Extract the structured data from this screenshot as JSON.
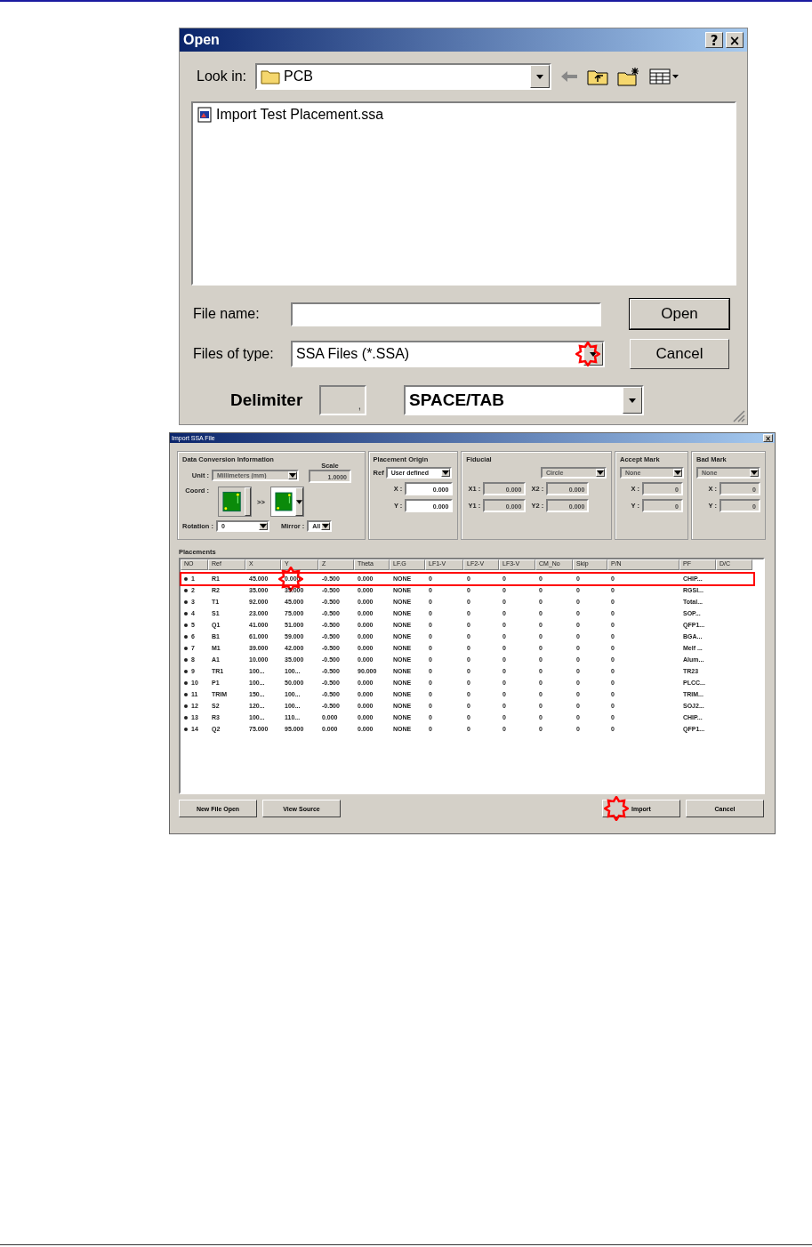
{
  "open_dialog": {
    "title": "Open",
    "title_buttons": [
      "?",
      "×"
    ],
    "look_in": {
      "label": "Look in:",
      "value": "PCB"
    },
    "files": [
      {
        "name": "Import Test Placement.ssa",
        "selected": false
      }
    ],
    "file_name": {
      "label": "File name:"
    },
    "files_of_type": {
      "label": "Files of type:",
      "value": "SSA Files (*.SSA)",
      "marked": true
    },
    "buttons": [
      {
        "label": "Open",
        "default": true
      },
      {
        "label": "Cancel",
        "default": false
      }
    ],
    "delimiter": {
      "label": "Delimiter",
      "char": ",",
      "disabled": true,
      "value": "SPACE/TAB"
    }
  },
  "import_dialog": {
    "title": "Import SSA File",
    "close": "×",
    "data_conversion": {
      "title": "Data Conversion Information",
      "unit": {
        "label": "Unit :",
        "value": "Millimeters (mm)",
        "disabled": true
      },
      "scale": {
        "label": "Scale",
        "value": "1.0000",
        "disabled": true
      },
      "coord": {
        "label": "Coord :",
        "arrow": ">>"
      },
      "rotation": {
        "label": "Rotation :",
        "value": "0",
        "disabled": false
      },
      "mirror": {
        "label": "Mirror :",
        "value": "All",
        "disabled": false
      }
    },
    "placement_origin": {
      "title": "Placement Origin",
      "ref": {
        "label": "Ref",
        "value": "User defined",
        "disabled": false
      },
      "fields": [
        {
          "label": "X :",
          "value": "0.000",
          "disabled": false
        },
        {
          "label": "Y :",
          "value": "0.000",
          "disabled": false
        }
      ]
    },
    "fiducial": {
      "title": "Fiducial",
      "shape": {
        "value": "Circle",
        "disabled": true
      },
      "fields": [
        {
          "label": "X1 :",
          "value": "0.000",
          "disabled": true
        },
        {
          "label": "X2 :",
          "value": "0.000",
          "disabled": true
        },
        {
          "label": "Y1 :",
          "value": "0.000",
          "disabled": true
        },
        {
          "label": "Y2 :",
          "value": "0.000",
          "disabled": true
        }
      ]
    },
    "accept_mark": {
      "title": "Accept Mark",
      "type": {
        "value": "None",
        "disabled": true
      },
      "fields": [
        {
          "label": "X :",
          "value": "0",
          "disabled": true
        },
        {
          "label": "Y :",
          "value": "0",
          "disabled": true
        }
      ]
    },
    "bad_mark": {
      "title": "Bad Mark",
      "type": {
        "value": "None",
        "disabled": true
      },
      "fields": [
        {
          "label": "X :",
          "value": "0",
          "disabled": true
        },
        {
          "label": "Y :",
          "value": "0",
          "disabled": true
        }
      ]
    },
    "placements": {
      "title": "Placements",
      "columns": [
        "NO",
        "Ref",
        "X",
        "Y",
        "Z",
        "Theta",
        "LF.G",
        "LF1-V",
        "LF2-V",
        "LF3-V",
        "CM_No",
        "Skip",
        "P/N",
        "PF",
        "D/C"
      ],
      "rows": [
        {
          "highlighted": true,
          "cells": [
            "1",
            "R1",
            "45.000",
            {
              "text": "0.000",
              "marked": true
            },
            "-0.500",
            "0.000",
            "NONE",
            "0",
            "0",
            "0",
            "0",
            "0",
            "0",
            "CHIP..."
          ]
        },
        {
          "highlighted": false,
          "cells": [
            "2",
            "R2",
            "35.000",
            "35.000",
            "-0.500",
            "0.000",
            "NONE",
            "0",
            "0",
            "0",
            "0",
            "0",
            "0",
            "RGSI..."
          ]
        },
        {
          "highlighted": false,
          "cells": [
            "3",
            "T1",
            "92.000",
            "45.000",
            "-0.500",
            "0.000",
            "NONE",
            "0",
            "0",
            "0",
            "0",
            "0",
            "0",
            "Total..."
          ]
        },
        {
          "highlighted": false,
          "cells": [
            "4",
            "S1",
            "23.000",
            "75.000",
            "-0.500",
            "0.000",
            "NONE",
            "0",
            "0",
            "0",
            "0",
            "0",
            "0",
            "SOP..."
          ]
        },
        {
          "highlighted": false,
          "cells": [
            "5",
            "Q1",
            "41.000",
            "51.000",
            "-0.500",
            "0.000",
            "NONE",
            "0",
            "0",
            "0",
            "0",
            "0",
            "0",
            "QFP1..."
          ]
        },
        {
          "highlighted": false,
          "cells": [
            "6",
            "B1",
            "61.000",
            "59.000",
            "-0.500",
            "0.000",
            "NONE",
            "0",
            "0",
            "0",
            "0",
            "0",
            "0",
            "BGA..."
          ]
        },
        {
          "highlighted": false,
          "cells": [
            "7",
            "M1",
            "39.000",
            "42.000",
            "-0.500",
            "0.000",
            "NONE",
            "0",
            "0",
            "0",
            "0",
            "0",
            "0",
            "Melf ..."
          ]
        },
        {
          "highlighted": false,
          "cells": [
            "8",
            "A1",
            "10.000",
            "35.000",
            "-0.500",
            "0.000",
            "NONE",
            "0",
            "0",
            "0",
            "0",
            "0",
            "0",
            "Alum..."
          ]
        },
        {
          "highlighted": false,
          "cells": [
            "9",
            "TR1",
            "100...",
            "100...",
            "-0.500",
            "90.000",
            "NONE",
            "0",
            "0",
            "0",
            "0",
            "0",
            "0",
            "TR23"
          ]
        },
        {
          "highlighted": false,
          "cells": [
            "10",
            "P1",
            "100...",
            "50.000",
            "-0.500",
            "0.000",
            "NONE",
            "0",
            "0",
            "0",
            "0",
            "0",
            "0",
            "PLCC..."
          ]
        },
        {
          "highlighted": false,
          "cells": [
            "11",
            "TRIM",
            "150...",
            "100...",
            "-0.500",
            "0.000",
            "NONE",
            "0",
            "0",
            "0",
            "0",
            "0",
            "0",
            "TRIM..."
          ]
        },
        {
          "highlighted": false,
          "cells": [
            "12",
            "S2",
            "120...",
            "100...",
            "-0.500",
            "0.000",
            "NONE",
            "0",
            "0",
            "0",
            "0",
            "0",
            "0",
            "SOJ2..."
          ]
        },
        {
          "highlighted": false,
          "cells": [
            "13",
            "R3",
            "100...",
            "110...",
            "0.000",
            "0.000",
            "NONE",
            "0",
            "0",
            "0",
            "0",
            "0",
            "0",
            "CHIP..."
          ]
        },
        {
          "highlighted": false,
          "cells": [
            "14",
            "Q2",
            "75.000",
            "95.000",
            "0.000",
            "0.000",
            "NONE",
            "0",
            "0",
            "0",
            "0",
            "0",
            "0",
            "QFP1..."
          ]
        }
      ]
    },
    "buttons": [
      {
        "label": "New File Open",
        "marked": false
      },
      {
        "label": "View Source",
        "marked": false
      },
      {
        "label": "Import",
        "marked": true
      },
      {
        "label": "Cancel",
        "marked": false
      }
    ]
  }
}
